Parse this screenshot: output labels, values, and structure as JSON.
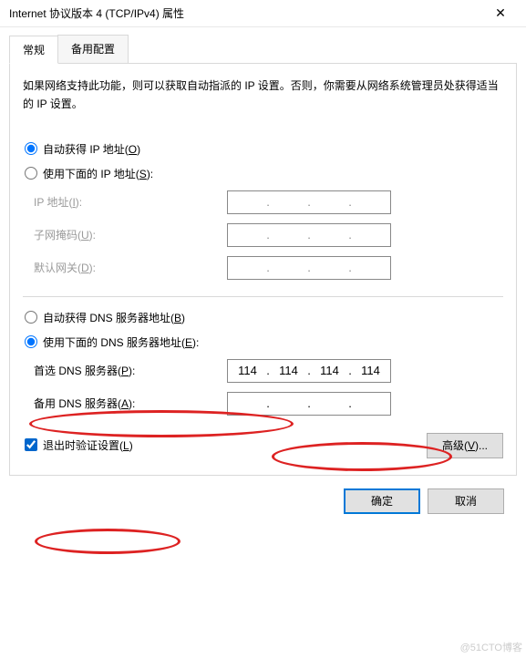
{
  "title": "Internet 协议版本 4 (TCP/IPv4) 属性",
  "tabs": {
    "general": "常规",
    "alternate": "备用配置"
  },
  "intro": "如果网络支持此功能，则可以获取自动指派的 IP 设置。否则，你需要从网络系统管理员处获得适当的 IP 设置。",
  "ip": {
    "auto_label_pre": "自动获得 IP 地址(",
    "auto_accel": "O",
    "auto_label_post": ")",
    "manual_label_pre": "使用下面的 IP 地址(",
    "manual_accel": "S",
    "manual_label_post": "):",
    "addr_label_pre": "IP 地址(",
    "addr_accel": "I",
    "addr_label_post": "):",
    "mask_label_pre": "子网掩码(",
    "mask_accel": "U",
    "mask_label_post": "):",
    "gw_label_pre": "默认网关(",
    "gw_accel": "D",
    "gw_label_post": "):",
    "selected": "auto"
  },
  "dns": {
    "auto_label_pre": "自动获得 DNS 服务器地址(",
    "auto_accel": "B",
    "auto_label_post": ")",
    "manual_label_pre": "使用下面的 DNS 服务器地址(",
    "manual_accel": "E",
    "manual_label_post": "):",
    "pref_label_pre": "首选 DNS 服务器(",
    "pref_accel": "P",
    "pref_label_post": "):",
    "alt_label_pre": "备用 DNS 服务器(",
    "alt_accel": "A",
    "alt_label_post": "):",
    "selected": "manual",
    "preferred": {
      "a": "114",
      "b": "114",
      "c": "114",
      "d": "114"
    },
    "alternate": {
      "a": "",
      "b": "",
      "c": "",
      "d": ""
    }
  },
  "validate": {
    "label_pre": "退出时验证设置(",
    "accel": "L",
    "label_post": ")",
    "checked": true
  },
  "buttons": {
    "advanced_pre": "高级(",
    "advanced_accel": "V",
    "advanced_post": ")...",
    "ok": "确定",
    "cancel": "取消"
  },
  "watermark": "@51CTO博客"
}
